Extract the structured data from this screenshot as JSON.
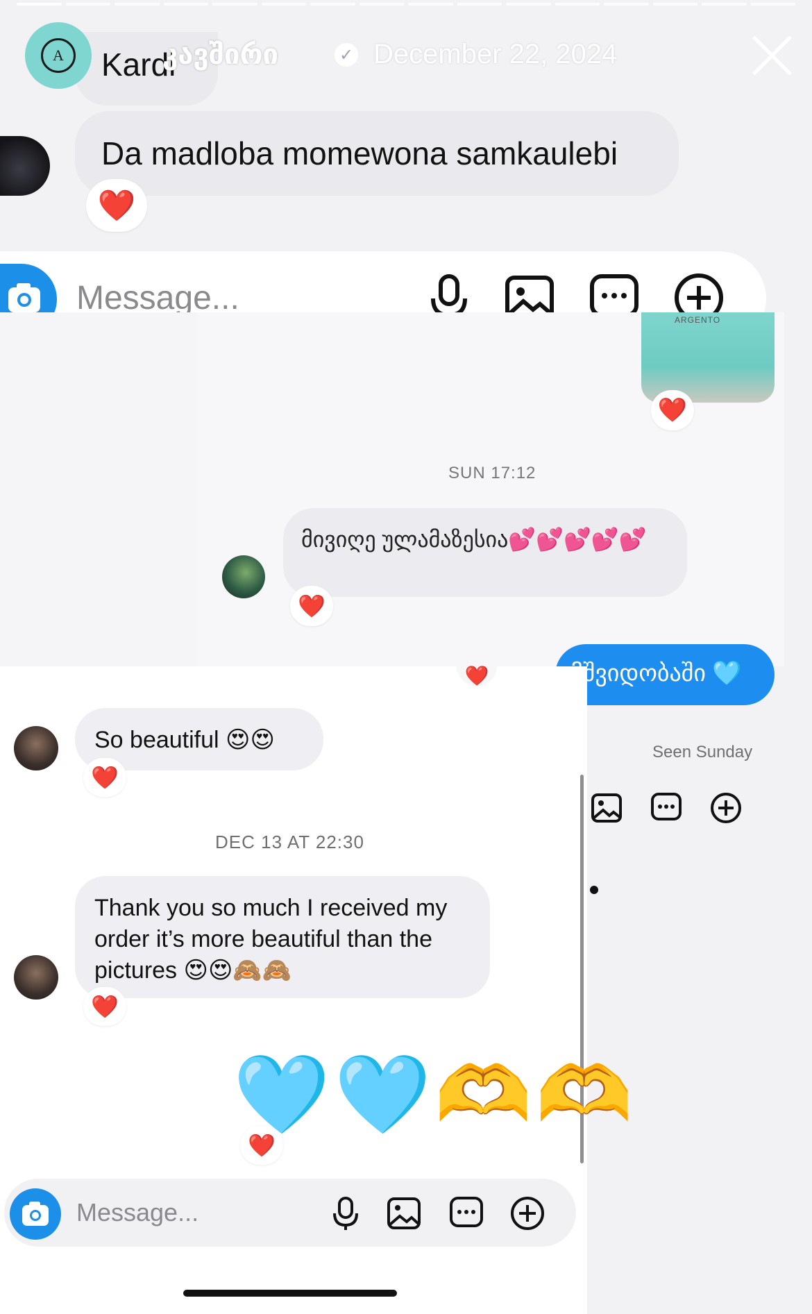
{
  "story": {
    "username": "კავშირი",
    "date": "December 22, 2024",
    "progress_segments": 16,
    "active_segment": 1
  },
  "logo_letter": "A",
  "conversation_top": {
    "partial_text": "Kardi",
    "message": "Da madloba momewona samkaulebi",
    "reaction": "❤️",
    "composer_placeholder": "Message..."
  },
  "conversation_mid": {
    "photo_label": "ARGENTO",
    "photo_reaction": "❤️",
    "timestamp": "SUN 17:12",
    "incoming_message": "მივიღე ულამაზესია💕💕💕💕💕",
    "incoming_reaction": "❤️",
    "outgoing_message": "მშვიდობაში 🩵",
    "seen": "Seen Sunday"
  },
  "conversation_bottom": {
    "message1": "So beautiful 😍😍",
    "reaction1": "❤️",
    "timestamp": "DEC 13 AT 22:30",
    "message2": "Thank you so much I received my order it’s more beautiful than the pictures 😍😍🙈🙈",
    "reaction2": "❤️",
    "big_emoji": "🩵🩵🫶🫶",
    "reaction3": "❤️",
    "composer_placeholder": "Message..."
  },
  "colors": {
    "accent_blue": "#1d8ef0",
    "story_avatar": "#7fd6d1",
    "bubble_gray": "#e9e9ee",
    "heart_red": "#e8213a"
  },
  "icons": [
    "camera-icon",
    "microphone-icon",
    "gallery-icon",
    "sticker-chat-icon",
    "plus-circle-icon",
    "close-icon",
    "verified-badge-icon"
  ]
}
